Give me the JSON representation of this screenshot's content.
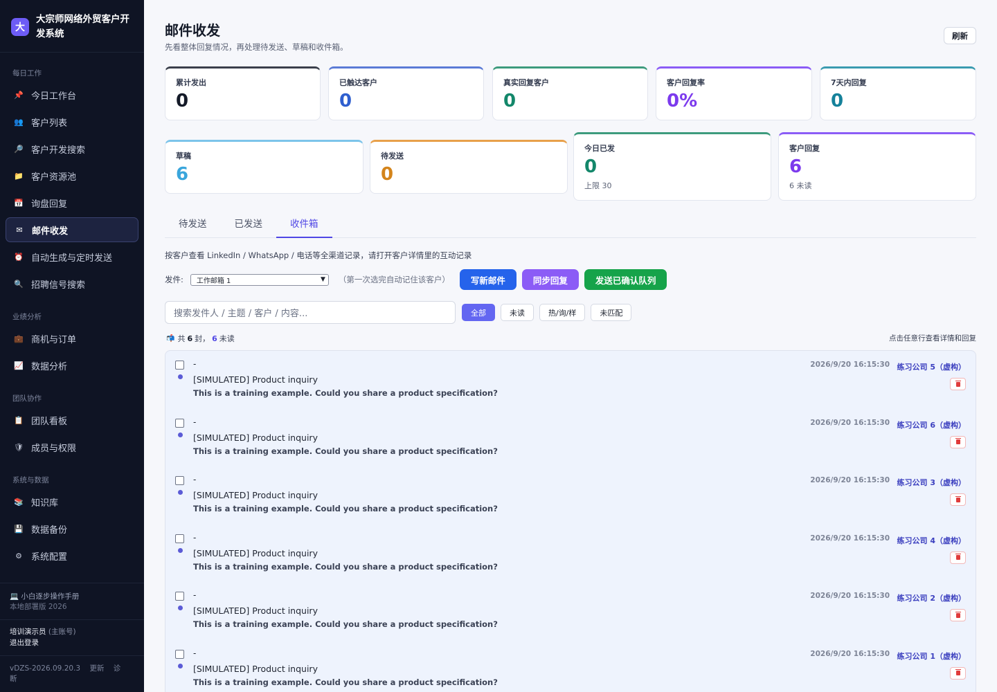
{
  "app": {
    "logo_char": "大",
    "title": "大宗师网络外贸客户开发系统"
  },
  "nav": [
    {
      "section": "每日工作",
      "items": [
        {
          "icon": "pin-icon",
          "glyph": "📌",
          "label": "今日工作台"
        },
        {
          "icon": "users-icon",
          "glyph": "👥",
          "label": "客户列表"
        },
        {
          "icon": "search-icon",
          "glyph": "🔎",
          "label": "客户开发搜索"
        },
        {
          "icon": "folder-icon",
          "glyph": "📁",
          "label": "客户资源池"
        },
        {
          "icon": "calendar-icon",
          "glyph": "📅",
          "label": "询盘回复"
        },
        {
          "icon": "mail-icon",
          "glyph": "✉",
          "label": "邮件收发",
          "active": true
        },
        {
          "icon": "alarm-clock-icon",
          "glyph": "⏰",
          "label": "自动生成与定时发送"
        },
        {
          "icon": "magnifier-icon",
          "glyph": "🔍",
          "label": "招聘信号搜索"
        }
      ]
    },
    {
      "section": "业绩分析",
      "items": [
        {
          "icon": "briefcase-icon",
          "glyph": "💼",
          "label": "商机与订单"
        },
        {
          "icon": "chart-icon",
          "glyph": "📈",
          "label": "数据分析"
        }
      ]
    },
    {
      "section": "团队协作",
      "items": [
        {
          "icon": "clipboard-icon",
          "glyph": "📋",
          "label": "团队看板"
        },
        {
          "icon": "shield-icon",
          "glyph": "🛡",
          "label": "成员与权限"
        }
      ]
    },
    {
      "section": "系统与数据",
      "items": [
        {
          "icon": "books-icon",
          "glyph": "📚",
          "label": "知识库"
        },
        {
          "icon": "disk-icon",
          "glyph": "💾",
          "label": "数据备份"
        },
        {
          "icon": "gear-icon",
          "glyph": "⚙",
          "label": "系统配置"
        }
      ]
    }
  ],
  "footer": {
    "manual": "💻 小白逐步操作手册",
    "manual_sub": "本地部署版 2026",
    "user": "培训演示员",
    "role": "(主账号)",
    "logout": "退出登录",
    "version": "vDZS-2026.09.20.3",
    "update": "更新",
    "diagnose": "诊断"
  },
  "page": {
    "title": "邮件收发",
    "subtitle": "先看整体回复情况，再处理待发送、草稿和收件箱。",
    "refresh": "刷新"
  },
  "stats_top": [
    {
      "label": "累计发出",
      "value": "0",
      "color": "#3a3f4b",
      "value_color": "#141a28"
    },
    {
      "label": "已触达客户",
      "value": "0",
      "color": "#5b7bd6",
      "value_color": "#2f5fcf"
    },
    {
      "label": "真实回复客户",
      "value": "0",
      "color": "#3d9b7d",
      "value_color": "#13876a"
    },
    {
      "label": "客户回复率",
      "value": "0%",
      "color": "#8b5cf6",
      "value_color": "#7c3aed"
    },
    {
      "label": "7天内回复",
      "value": "0",
      "color": "#3a9bb0",
      "value_color": "#15819a"
    }
  ],
  "stats_bottom": [
    {
      "label": "草稿",
      "value": "6",
      "color": "#7cc4ea",
      "value_color": "#3aa6dc",
      "note": ""
    },
    {
      "label": "待发送",
      "value": "0",
      "color": "#e8a04a",
      "value_color": "#d4841b",
      "note": ""
    },
    {
      "label": "今日已发",
      "value": "0",
      "color": "#3d9b7d",
      "value_color": "#13876a",
      "note": "上限 30"
    },
    {
      "label": "客户回复",
      "value": "6",
      "color": "#8b5cf6",
      "value_color": "#7c3aed",
      "note": "6 未读"
    }
  ],
  "tabs": [
    "待发送",
    "已发送",
    "收件箱"
  ],
  "active_tab": "收件箱",
  "hint": "按客户查看 LinkedIn / WhatsApp / 电话等全渠道记录，请打开客户详情里的互动记录",
  "from": {
    "label": "发件:",
    "selected": "工作邮箱 1",
    "note": "（第一次选完自动记住该客户）"
  },
  "actions": [
    {
      "label": "写新邮件",
      "color": "#2563eb"
    },
    {
      "label": "同步回复",
      "color": "#8b5cf6"
    },
    {
      "label": "发送已确认队列",
      "color": "#16a34a"
    }
  ],
  "search": {
    "placeholder": "搜索发件人 / 主题 / 客户 / 内容..."
  },
  "filters": [
    "全部",
    "未读",
    "热/询/样",
    "未匹配"
  ],
  "active_filter": "全部",
  "summary": {
    "icon": "📬",
    "prefix": "共",
    "total": "6",
    "mid": "封，",
    "unread": "6",
    "suffix": "未读"
  },
  "summary_hint": "点击任意行查看详情和回复",
  "mails": [
    {
      "from": "-",
      "subject": "[SIMULATED] Product inquiry",
      "preview": "This is a training example. Could you share a product specification?",
      "time": "2026/9/20 16:15:30",
      "customer": "练习公司 5（虚构）"
    },
    {
      "from": "-",
      "subject": "[SIMULATED] Product inquiry",
      "preview": "This is a training example. Could you share a product specification?",
      "time": "2026/9/20 16:15:30",
      "customer": "练习公司 6（虚构）"
    },
    {
      "from": "-",
      "subject": "[SIMULATED] Product inquiry",
      "preview": "This is a training example. Could you share a product specification?",
      "time": "2026/9/20 16:15:30",
      "customer": "练习公司 3（虚构）"
    },
    {
      "from": "-",
      "subject": "[SIMULATED] Product inquiry",
      "preview": "This is a training example. Could you share a product specification?",
      "time": "2026/9/20 16:15:30",
      "customer": "练习公司 4（虚构）"
    },
    {
      "from": "-",
      "subject": "[SIMULATED] Product inquiry",
      "preview": "This is a training example. Could you share a product specification?",
      "time": "2026/9/20 16:15:30",
      "customer": "练习公司 2（虚构）"
    },
    {
      "from": "-",
      "subject": "[SIMULATED] Product inquiry",
      "preview": "This is a training example. Could you share a product specification?",
      "time": "2026/9/20 16:15:30",
      "customer": "练习公司 1（虚构）"
    }
  ]
}
